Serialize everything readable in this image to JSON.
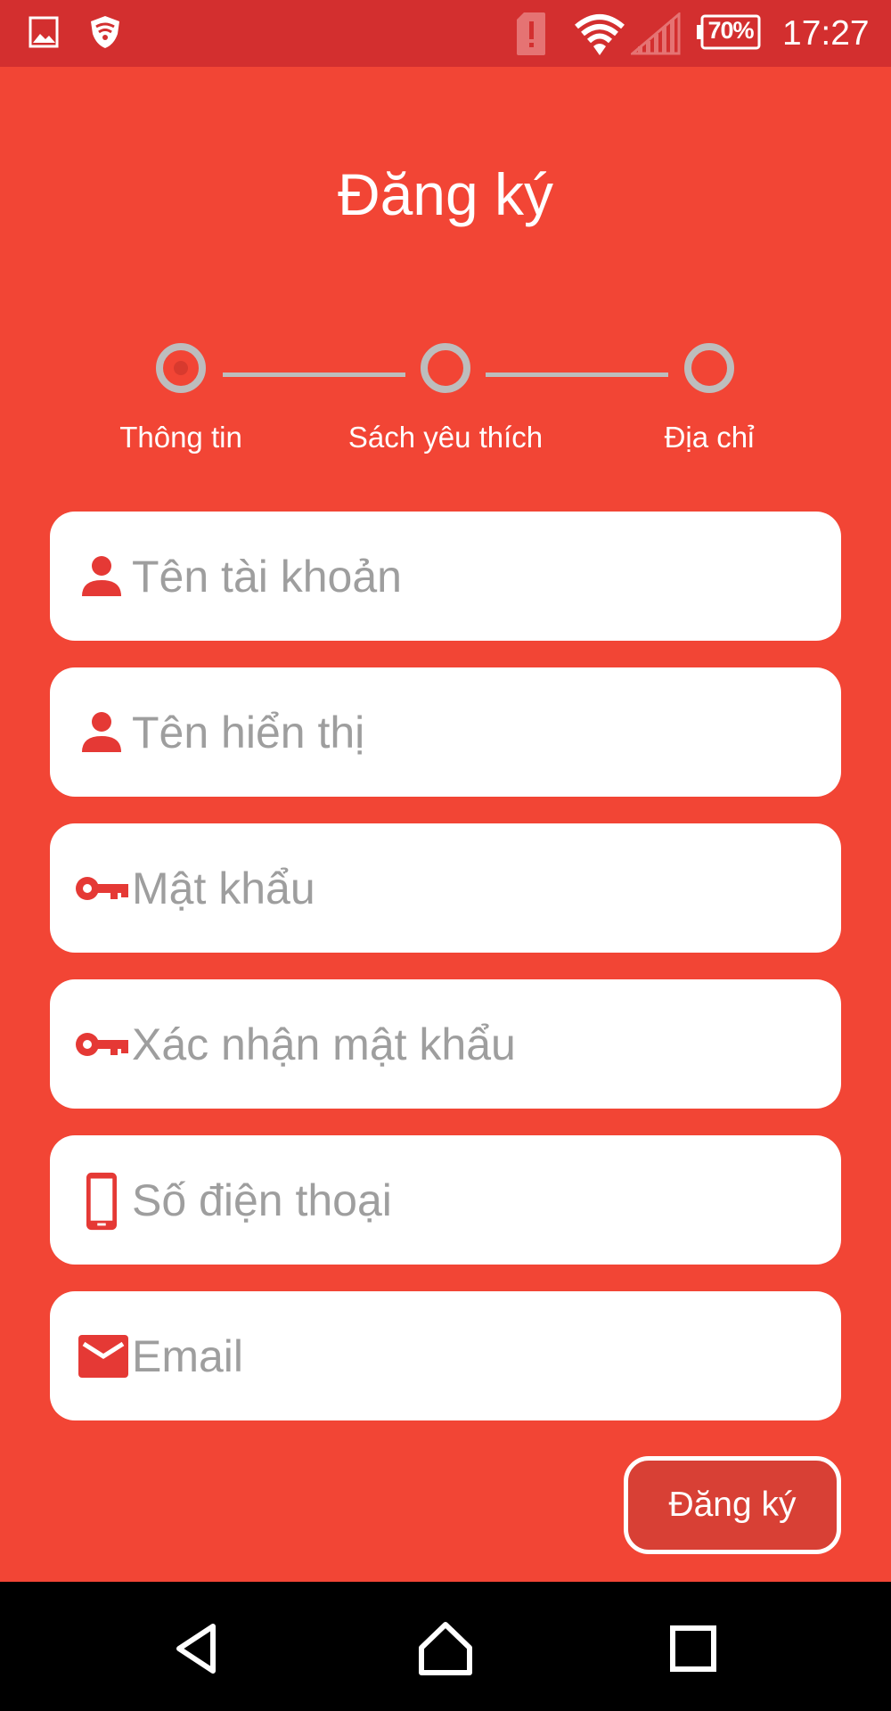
{
  "status_bar": {
    "battery": "70%",
    "time": "17:27"
  },
  "title": "Đăng ký",
  "steps": [
    {
      "label": "Thông tin",
      "active": true
    },
    {
      "label": "Sách yêu thích",
      "active": false
    },
    {
      "label": "Địa chỉ",
      "active": false
    }
  ],
  "form": {
    "username": {
      "placeholder": "Tên tài khoản",
      "icon": "person-icon"
    },
    "display_name": {
      "placeholder": "Tên hiển thị",
      "icon": "person-icon"
    },
    "password": {
      "placeholder": "Mật khẩu",
      "icon": "key-icon"
    },
    "confirm_password": {
      "placeholder": "Xác nhận mật khẩu",
      "icon": "key-icon"
    },
    "phone": {
      "placeholder": "Số điện thoại",
      "icon": "phone-icon"
    },
    "email": {
      "placeholder": "Email",
      "icon": "mail-icon"
    }
  },
  "submit_label": "Đăng ký",
  "colors": {
    "background": "#f24535",
    "status_bar": "#d32f2f",
    "accent": "#e53935",
    "step_inactive": "#bdbdbd"
  }
}
